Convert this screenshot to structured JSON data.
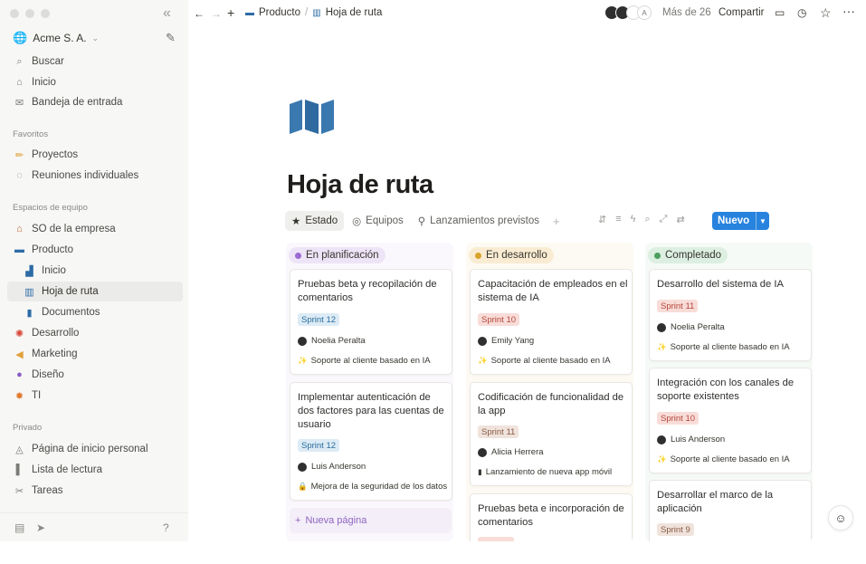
{
  "sidebar": {
    "workspace_name": "Acme S. A.",
    "top_items": [
      {
        "label": "Buscar",
        "icon": "search-icon"
      },
      {
        "label": "Inicio",
        "icon": "home-icon"
      },
      {
        "label": "Bandeja de entrada",
        "icon": "inbox-icon"
      }
    ],
    "favorites_title": "Favoritos",
    "favorites": [
      {
        "label": "Proyectos",
        "icon": "pencil-icon"
      },
      {
        "label": "Reuniones individuales",
        "icon": "chat-bubble-icon"
      }
    ],
    "team_title": "Espacios de equipo",
    "team": [
      {
        "label": "SO de la empresa",
        "icon": "house-icon"
      },
      {
        "label": "Producto",
        "icon": "laptop-icon"
      },
      {
        "label": "Inicio",
        "icon": "chart-icon"
      },
      {
        "label": "Hoja de ruta",
        "icon": "map-icon"
      },
      {
        "label": "Documentos",
        "icon": "bookmark-icon"
      },
      {
        "label": "Desarrollo",
        "icon": "gear-icon"
      },
      {
        "label": "Marketing",
        "icon": "megaphone-icon"
      },
      {
        "label": "Diseño",
        "icon": "palette-icon"
      },
      {
        "label": "TI",
        "icon": "bug-icon"
      }
    ],
    "private_title": "Privado",
    "private": [
      {
        "label": "Página de inicio personal",
        "icon": "ruler-icon"
      },
      {
        "label": "Lista de lectura",
        "icon": "book-icon"
      },
      {
        "label": "Tareas",
        "icon": "scissors-icon"
      }
    ]
  },
  "topbar": {
    "breadcrumb": [
      "Producto",
      "Hoja de ruta"
    ],
    "more_people": "Más de 26",
    "share_label": "Compartir",
    "avatar_initial": "A"
  },
  "page": {
    "title": "Hoja de ruta",
    "views": [
      {
        "label": "Estado",
        "icon": "star-icon"
      },
      {
        "label": "Equipos",
        "icon": "target-icon"
      },
      {
        "label": "Lanzamientos previstos",
        "icon": "pin-icon"
      }
    ],
    "new_label": "Nuevo",
    "new_page_label": "Nueva página"
  },
  "columns": [
    {
      "title": "En planificación",
      "cards": [
        {
          "title": "Pruebas beta y recopilación de comentarios",
          "tag": "Sprint 12",
          "person": "Noelia Peralta",
          "project": "Soporte al cliente basado en IA"
        },
        {
          "title": "Implementar autenticación de dos factores para las cuentas de usuario",
          "tag": "Sprint 12",
          "person": "Luis Anderson",
          "project": "Mejora de la seguridad de los datos"
        }
      ]
    },
    {
      "title": "En desarrollo",
      "cards": [
        {
          "title": "Capacitación de empleados en el sistema de IA",
          "tag": "Sprint 10",
          "person": "Emily Yang",
          "project": "Soporte al cliente basado en IA"
        },
        {
          "title": "Codificación de funcionalidad de la app",
          "tag": "Sprint 11",
          "person": "Alicia Herrera",
          "project": "Lanzamiento de nueva app móvil"
        },
        {
          "title": "Pruebas beta e incorporación de comentarios"
        }
      ]
    },
    {
      "title": "Completado",
      "cards": [
        {
          "title": "Desarrollo del sistema de IA",
          "tag": "Sprint 11",
          "person": "Noelia Peralta",
          "project": "Soporte al cliente basado en IA"
        },
        {
          "title": "Integración con los canales de soporte existentes",
          "tag": "Sprint 10",
          "person": "Luis Anderson",
          "project": "Soporte al cliente basado en IA"
        },
        {
          "title": "Desarrollar el marco de la aplicación",
          "tag": "Sprint 9"
        }
      ]
    }
  ],
  "colors": {
    "accent": "#2783de",
    "sidebar_bg": "#f7f7f5"
  }
}
